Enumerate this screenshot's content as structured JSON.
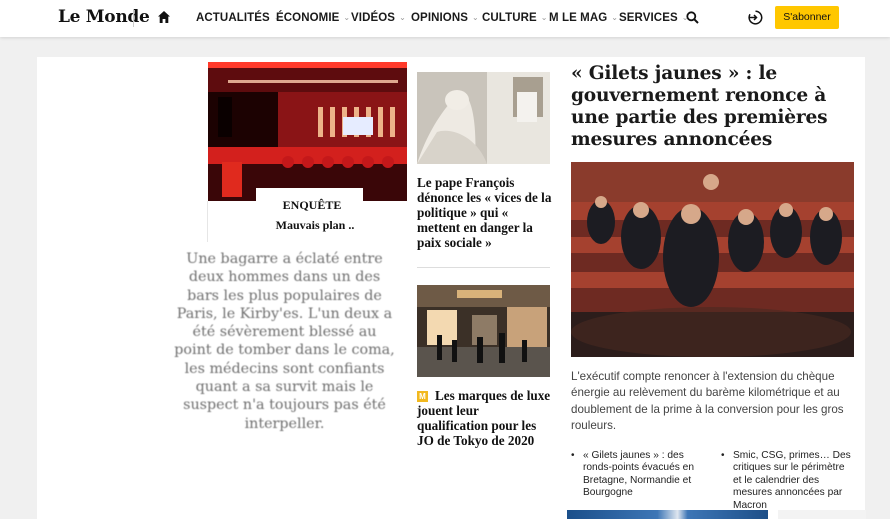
{
  "nav": {
    "logo": "Le Monde",
    "home_icon": "home-icon",
    "menu": [
      {
        "label": "ACTUALITÉS",
        "has_dropdown": true
      },
      {
        "label": "ÉCONOMIE",
        "has_dropdown": true
      },
      {
        "label": "VIDÉOS",
        "has_dropdown": true
      },
      {
        "label": "OPINIONS",
        "has_dropdown": true
      },
      {
        "label": "CULTURE",
        "has_dropdown": true
      },
      {
        "label": "M LE MAG",
        "has_dropdown": true
      },
      {
        "label": "SERVICES",
        "has_dropdown": true
      }
    ],
    "search_icon": "search-icon",
    "account_icon": "account-icon",
    "subscribe_label": "S'abonner",
    "subscribe_color": "#ffc700"
  },
  "feature": {
    "kicker": "ENQUÊTE",
    "subtitle": "Mauvais plan ..",
    "text": "Une bagarre a éclaté entre deux hommes dans un des bars les plus populaires de Paris, le Kirby'es. L'un deux a été sévèrement blessé au point de tomber dans le coma, les médecins sont confiants quant a sa survit mais le suspect n'a toujours pas été interpeller."
  },
  "middle": {
    "pope_title": "Le pape François dénonce les « vices de la politique » qui « mettent en danger la paix sociale »",
    "luxury_badge": "m-badge-icon",
    "luxury_title": "Les marques de luxe jouent leur qualification pour les JO de Tokyo de 2020"
  },
  "main_story": {
    "title": "« Gilets jaunes » : le gouvernement renonce à une partie des premières mesures annoncées",
    "summary": "L'exécutif compte renoncer à l'extension du chèque énergie au relèvement du barème kilométrique et au doublement de la prime à la conversion pour les gros rouleurs.",
    "related": [
      "« Gilets jaunes » : des ronds-points évacués en Bretagne, Normandie et Bourgogne",
      "Smic, CSG, primes… Des critiques sur le périmètre et le calendrier des mesures annoncées par Macron"
    ]
  }
}
